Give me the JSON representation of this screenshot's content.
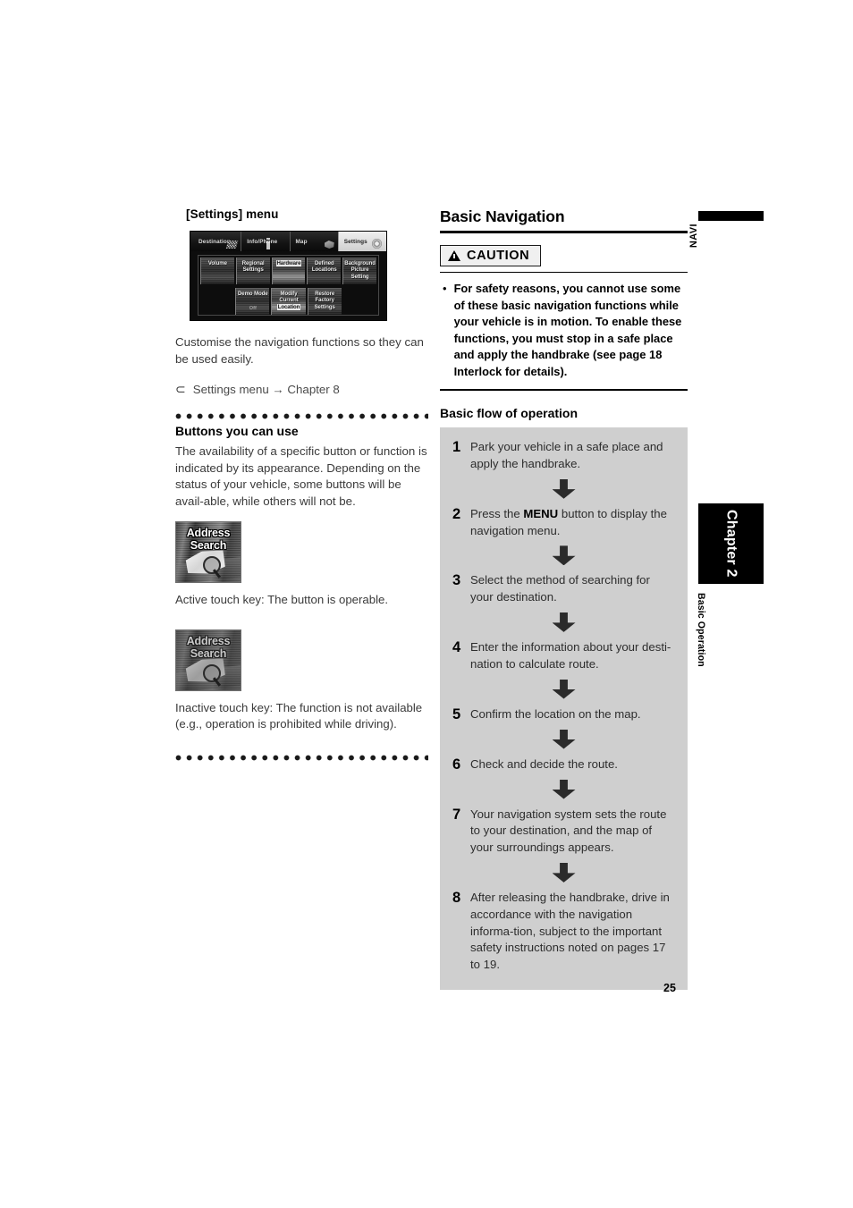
{
  "page": {
    "number": "25"
  },
  "left_column": {
    "settings_menu_caption": "[Settings] menu",
    "nav_screenshot": {
      "top_bar": [
        {
          "label": "Destination",
          "icon": "checkered-flag-icon",
          "selected": false
        },
        {
          "label": "Info/Phone",
          "icon": "info-icon",
          "selected": false
        },
        {
          "label": "Map",
          "icon": "map-icon",
          "selected": false
        },
        {
          "label": "Settings",
          "icon": "gear-icon",
          "selected": true
        }
      ],
      "row1_keys": [
        {
          "label": "Volume",
          "highlighted": false
        },
        {
          "label": "Regional Settings",
          "highlighted": false
        },
        {
          "label": "Hardware",
          "highlighted": true
        },
        {
          "label": "Defined Locations",
          "highlighted": false
        },
        {
          "label": "Background Picture Setting",
          "highlighted": false
        }
      ],
      "row2_keys": [
        {
          "label": "Demo Mode",
          "sub": "Off",
          "highlighted": false
        },
        {
          "label": "Modify Current",
          "highlight_word": "Location",
          "highlighted": true
        },
        {
          "label": "Restore Factory Settings",
          "highlighted": false
        }
      ]
    },
    "intro_paragraph": "Customise the navigation functions so they can be used easily.",
    "reference": {
      "arrow_glyph": "⊃",
      "text": "Settings menu → Chapter 8"
    },
    "buttons_section": {
      "title": "Buttons you can use",
      "paragraph": "The availability of a specific button or function is indicated by its appearance. Depending on the status of your vehicle, some buttons will be avail-able, while others will not be.",
      "active_key": {
        "line1": "Address",
        "line2": "Search",
        "caption": "Active touch key: The button is operable."
      },
      "inactive_key": {
        "line1": "Address",
        "line2": "Search",
        "caption": "Inactive touch key: The function is not available (e.g., operation is prohibited while driving)."
      }
    }
  },
  "right_column": {
    "heading": "Basic Navigation",
    "caution": {
      "label": "CAUTION",
      "bullet": "•",
      "text": "For safety reasons, you cannot use some of these basic navigation functions while your vehicle is in motion. To enable these functions, you must stop in a safe place and apply the handbrake (see page 18 Interlock for details)."
    },
    "flow_heading": "Basic flow of operation",
    "flow_steps": [
      {
        "num": "1",
        "text": "Park your vehicle in a safe place and apply the handbrake."
      },
      {
        "num": "2",
        "text_pre": "Press the ",
        "text_bold": "MENU",
        "text_post": " button to display the navigation menu."
      },
      {
        "num": "3",
        "text": "Select the method of searching for your destination."
      },
      {
        "num": "4",
        "text": "Enter the information about your desti-nation to calculate route."
      },
      {
        "num": "5",
        "text": "Confirm the location on the map."
      },
      {
        "num": "6",
        "text": "Check and decide the route."
      },
      {
        "num": "7",
        "text": "Your navigation system sets the route to your destination, and the map of your surroundings appears."
      },
      {
        "num": "8",
        "text": "After releasing the handbrake, drive in accordance with the navigation informa-tion, subject to the important safety instructions noted on pages 17 to 19."
      }
    ]
  },
  "margin_tabs": {
    "navi_label": "NAVI",
    "chapter_label": "Chapter 2",
    "section_label": "Basic Operation"
  }
}
